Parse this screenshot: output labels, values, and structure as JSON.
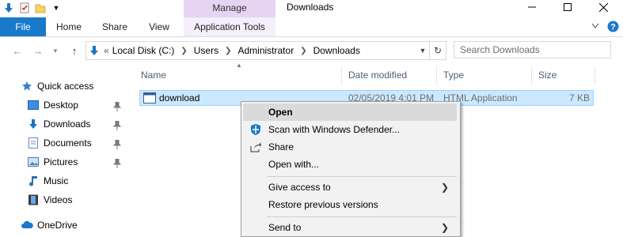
{
  "title_bar": {
    "manage_label": "Manage",
    "window_title": "Downloads"
  },
  "ribbon": {
    "tabs": [
      "File",
      "Home",
      "Share",
      "View",
      "Application Tools"
    ]
  },
  "address": {
    "prefix": "«",
    "crumbs": [
      "Local Disk (C:)",
      "Users",
      "Administrator",
      "Downloads"
    ],
    "search_placeholder": "Search Downloads"
  },
  "nav_pane": {
    "items": [
      {
        "label": "Quick access",
        "icon": "star-icon"
      },
      {
        "label": "Desktop",
        "icon": "desktop-icon"
      },
      {
        "label": "Downloads",
        "icon": "download-arrow-icon"
      },
      {
        "label": "Documents",
        "icon": "documents-icon"
      },
      {
        "label": "Pictures",
        "icon": "pictures-icon"
      },
      {
        "label": "Music",
        "icon": "music-icon"
      },
      {
        "label": "Videos",
        "icon": "videos-icon"
      },
      {
        "label": "OneDrive",
        "icon": "cloud-icon"
      }
    ]
  },
  "file_list": {
    "columns": [
      "Name",
      "Date modified",
      "Type",
      "Size"
    ],
    "rows": [
      {
        "name": "download",
        "date": "02/05/2019 4:01 PM",
        "type": "HTML Application",
        "size": "7 KB"
      }
    ]
  },
  "context_menu": {
    "items": [
      {
        "label": "Open",
        "bold": true,
        "highlighted": true
      },
      {
        "label": "Scan with Windows Defender...",
        "icon": "defender-shield-icon"
      },
      {
        "label": "Share",
        "icon": "share-icon"
      },
      {
        "label": "Open with..."
      },
      {
        "label": "Give access to",
        "submenu": true
      },
      {
        "label": "Restore previous versions"
      },
      {
        "label": "Send to",
        "submenu": true
      }
    ]
  },
  "colors": {
    "file_tab": "#1979ca",
    "manage_bg": "#e6d4f2",
    "selection": "#cce8ff",
    "menu_bg": "#f2f2f2"
  }
}
